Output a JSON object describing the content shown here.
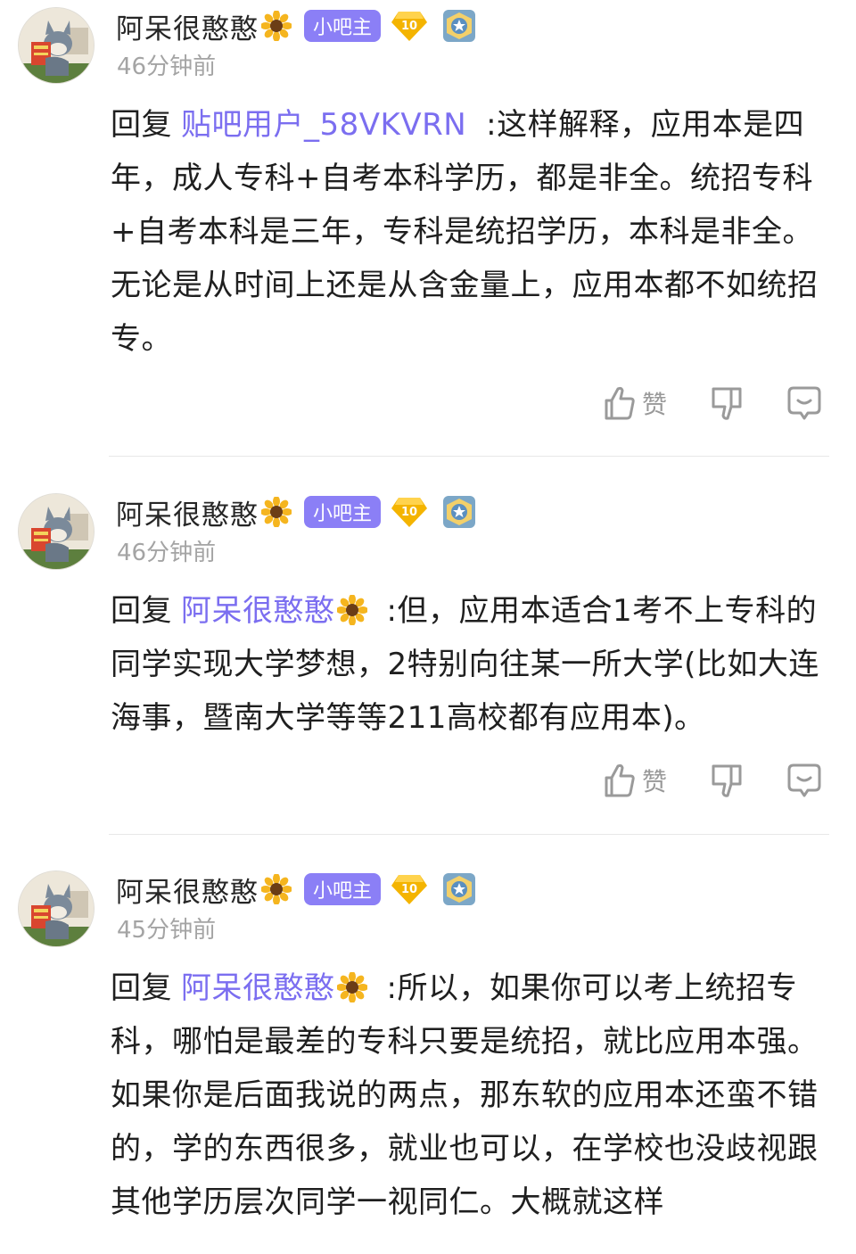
{
  "colors": {
    "accent": "#7b6ef0",
    "admin_badge": "#8b7ff6",
    "level_badge": "#f4b400",
    "muted": "#a4a4a4"
  },
  "icons": {
    "avatar": "tom-cat-avatar",
    "flair": "sunflower-icon",
    "level": "level-gem-icon",
    "medal": "medal-icon",
    "like": "thumbs-up-icon",
    "dislike": "thumbs-down-icon",
    "reply": "comment-icon"
  },
  "comments": [
    {
      "username": "阿呆很憨憨",
      "badge": "小吧主",
      "level": "10",
      "time": "46分钟前",
      "reply_prefix": "回复",
      "reply_to": "贴吧用户_58VKVRN",
      "reply_to_has_flair": false,
      "text": ":这样解释，应用本是四年，成人专科+自考本科学历，都是非全。统招专科+自考本科是三年，专科是统招学历，本科是非全。无论是从时间上还是从含金量上，应用本都不如统招专。",
      "like_label": "赞"
    },
    {
      "username": "阿呆很憨憨",
      "badge": "小吧主",
      "level": "10",
      "time": "46分钟前",
      "reply_prefix": "回复",
      "reply_to": "阿呆很憨憨",
      "reply_to_has_flair": true,
      "text": ":但，应用本适合1考不上专科的同学实现大学梦想，2特别向往某一所大学(比如大连海事，暨南大学等等211高校都有应用本)。",
      "like_label": "赞"
    },
    {
      "username": "阿呆很憨憨",
      "badge": "小吧主",
      "level": "10",
      "time": "45分钟前",
      "reply_prefix": "回复",
      "reply_to": "阿呆很憨憨",
      "reply_to_has_flair": true,
      "text": ":所以，如果你可以考上统招专科，哪怕是最差的专科只要是统招，就比应用本强。如果你是后面我说的两点，那东软的应用本还蛮不错的，学的东西很多，就业也可以，在学校也没歧视跟其他学历层次同学一视同仁。大概就这样"
    }
  ]
}
